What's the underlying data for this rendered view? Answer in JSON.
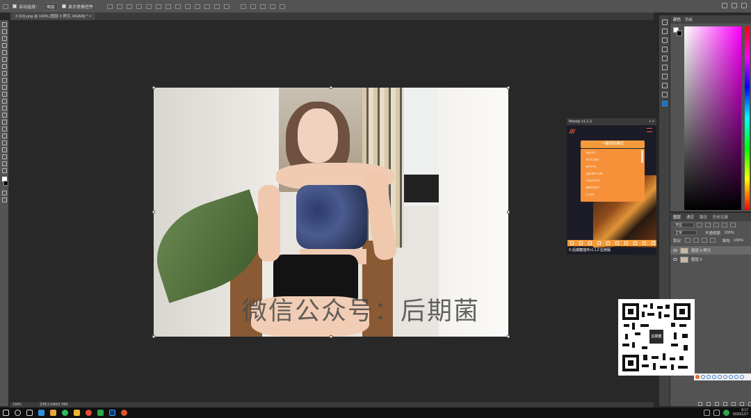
{
  "options_bar": {
    "auto_select_label": "自动选择：",
    "auto_select_value": "图层",
    "show_transform_label": "显示变换控件"
  },
  "document": {
    "tab_title": "3 (10).png @ 100% (图层 0 拷贝, RGB/8) *",
    "zoom": "100%",
    "file_info": "文档:2.69M/3.78M"
  },
  "watermark_text": "微信公众号：后期菌",
  "color_panel": {
    "tabs": [
      "颜色",
      "色板"
    ],
    "active_tab": 0,
    "hue_color": "#ff00ff"
  },
  "layers_panel": {
    "tabs": [
      "图层",
      "通道",
      "路径",
      "历史记录"
    ],
    "kind_label": "类型",
    "blend_mode": "正常",
    "opacity_label": "不透明度:",
    "opacity_value": "100%",
    "lock_label": "锁定:",
    "fill_label": "填充:",
    "fill_value": "100%",
    "layers": [
      {
        "name": "图层 0 拷贝",
        "selected": true
      },
      {
        "name": "图层 0",
        "selected": false
      }
    ]
  },
  "moody_plugin": {
    "title": "Moody v1.1.2",
    "main_button": "一键调色模式",
    "options": [
      "NEXT",
      "NYLON",
      "NYFR",
      "QUIETUS",
      "CHAYEY",
      "MOODY",
      "LA31"
    ],
    "accent": "#f39b3c",
    "footer": "© 后期菌插件v1.1.2 应用版"
  },
  "qr": {
    "center_label": "后期菌"
  },
  "taskbar": {
    "time": "8:17",
    "date": "2020/12/7",
    "icons": [
      "start-icon",
      "search-icon",
      "task-view-icon",
      "file-explorer-icon",
      "store-icon",
      "chrome-icon",
      "folder-icon",
      "browser-icon",
      "media-icon",
      "photoshop-icon",
      "game-icon"
    ]
  }
}
